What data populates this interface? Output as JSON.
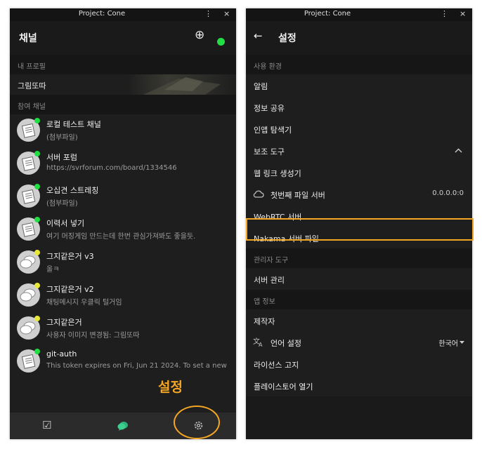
{
  "left_window": {
    "window_title": "Project: Cone",
    "menu_glyph": "⋮",
    "close_glyph": "×",
    "header": {
      "title": "채널",
      "add_glyph": "⊕",
      "status_color": "#22dd44"
    },
    "profile_section": "내 프로필",
    "profile_name": "그림또따",
    "channels_section": "참여 채널",
    "channels": [
      {
        "name": "로컬 테스트 채널",
        "sub": "(첨부파일)",
        "dot": "#22dd44",
        "avatar": "doc"
      },
      {
        "name": "서버 포럼",
        "sub": "https://svrforum.com/board/1334546",
        "dot": "#22dd44",
        "avatar": "doc"
      },
      {
        "name": "오십견 스트레칭",
        "sub": "(첨부파일)",
        "dot": "#22dd44",
        "avatar": "doc"
      },
      {
        "name": "이력서 넣기",
        "sub": "여기 머징게임 만드는데 한번 관심가져봐도 좋을듯.",
        "dot": "#22dd44",
        "avatar": "doc"
      },
      {
        "name": "그지같은거 v3",
        "sub": "올ㅋ",
        "dot": "#e8e83a",
        "avatar": "chat"
      },
      {
        "name": "그지같은거 v2",
        "sub": "채팅메시지 우클릭 털거임",
        "dot": "#e8e83a",
        "avatar": "chat"
      },
      {
        "name": "그지같은거",
        "sub": "사용자 이미지 변경됨: 그림또따",
        "dot": "#e8e83a",
        "avatar": "chat"
      },
      {
        "name": "git-auth",
        "sub": "This token expires on Fri, Jun 21 2024. To set a new",
        "dot": "#22dd44",
        "avatar": "doc"
      }
    ],
    "nav": {
      "todo_glyph": "☑",
      "chat_accent": "#2fb37a",
      "settings_glyph": "⚙"
    }
  },
  "annotation": {
    "label": "설정",
    "color": "#f5a623"
  },
  "right_window": {
    "window_title": "Project: Cone",
    "menu_glyph": "⋮",
    "close_glyph": "×",
    "header": {
      "title": "설정",
      "back_glyph": "←"
    },
    "sections": {
      "env": "사용 환경",
      "admin": "관리자 도구",
      "app_info": "앱 정보"
    },
    "rows": {
      "alarm": "알림",
      "share": "정보 공유",
      "inapp": "인앱 탐색기",
      "tools": "보조 도구",
      "web_link": "웹 링크 생성기",
      "first_server": "첫번째 파일 서버",
      "first_server_value": "0.0.0.0:0",
      "webrtc": "WebRTC 서버",
      "nakama": "Nakama 서버 파일",
      "server_admin": "서버 관리",
      "maker": "제작자",
      "language": "언어 설정",
      "language_value": "한국어",
      "license": "라이선스 고지",
      "playstore": "플레이스토어 열기"
    }
  }
}
